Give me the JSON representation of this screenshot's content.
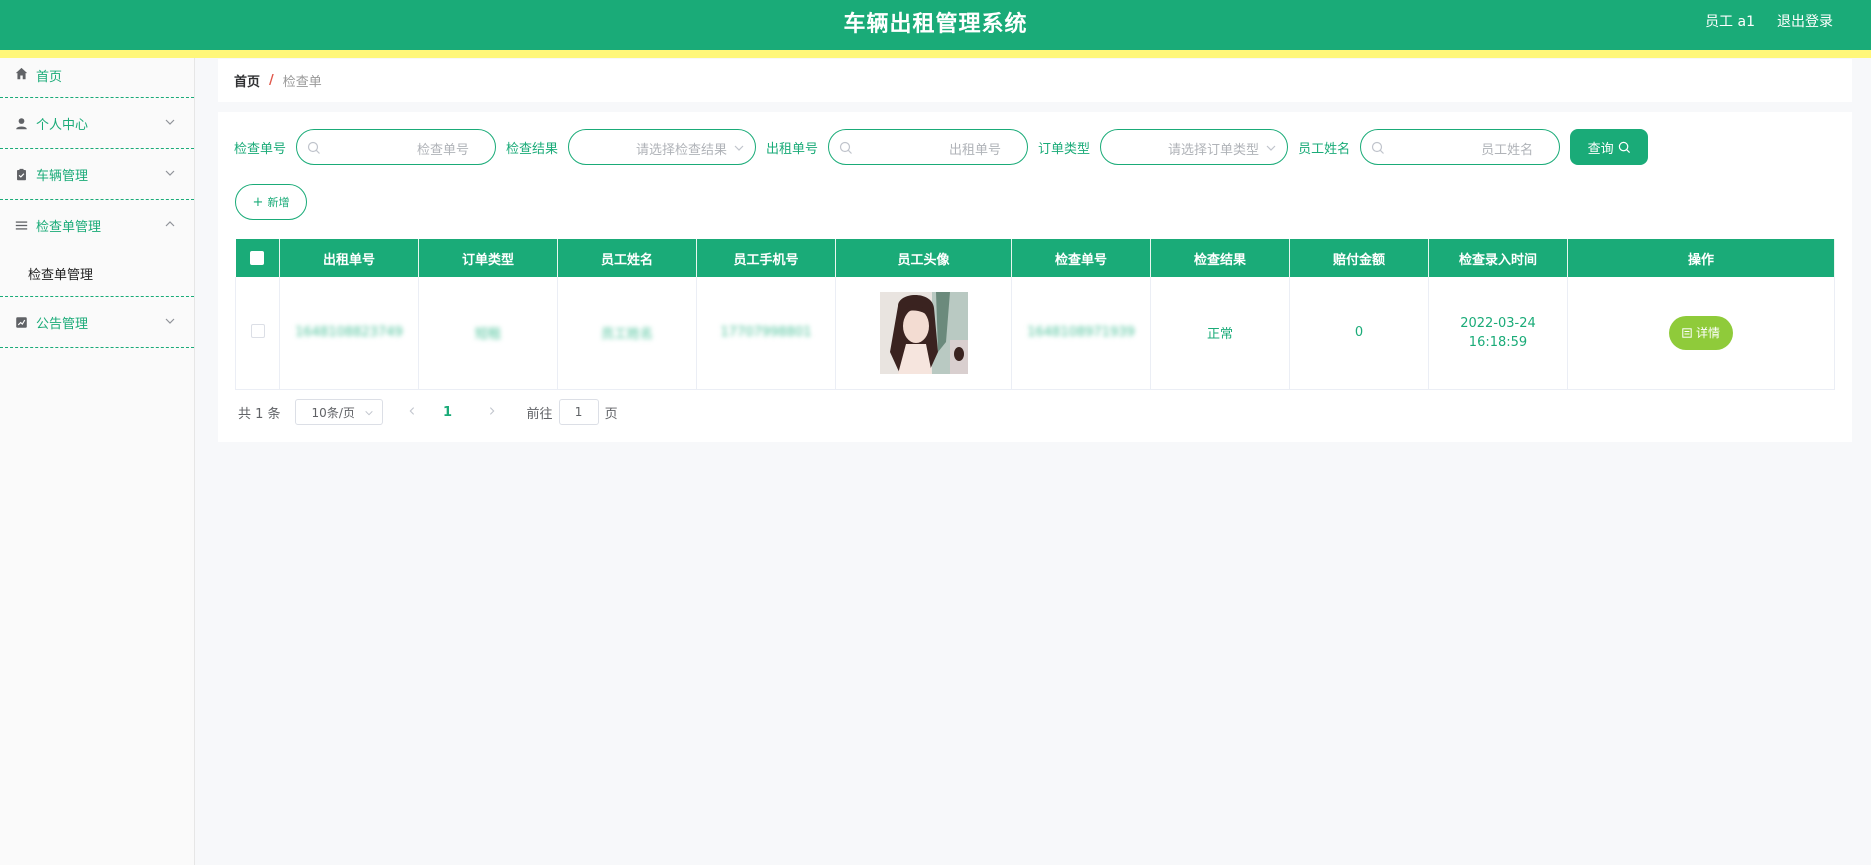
{
  "header": {
    "title": "车辆出租管理系统",
    "user": "员工 a1",
    "logout": "退出登录"
  },
  "sidebar": {
    "items": [
      {
        "label": "首页",
        "icon": "home-icon"
      },
      {
        "label": "个人中心",
        "icon": "user-icon"
      },
      {
        "label": "车辆管理",
        "icon": "clipboard-icon"
      },
      {
        "label": "检查单管理",
        "icon": "list-icon"
      },
      {
        "label": "公告管理",
        "icon": "chart-icon"
      }
    ],
    "submenu": "检查单管理"
  },
  "breadcrumb": {
    "home": "首页",
    "separator": "/",
    "current": "检查单"
  },
  "search": {
    "check_no_label": "检查单号",
    "check_no_placeholder": "检查单号",
    "result_label": "检查结果",
    "result_placeholder": "请选择检查结果",
    "rental_no_label": "出租单号",
    "rental_no_placeholder": "出租单号",
    "order_type_label": "订单类型",
    "order_type_placeholder": "请选择订单类型",
    "employee_label": "员工姓名",
    "employee_placeholder": "员工姓名",
    "query_button": "查询"
  },
  "actions": {
    "add_button": "新增"
  },
  "table": {
    "columns": [
      "出租单号",
      "订单类型",
      "员工姓名",
      "员工手机号",
      "员工头像",
      "检查单号",
      "检查结果",
      "赔付金额",
      "检查录入时间",
      "操作"
    ],
    "rows": [
      {
        "rental_no": "1648108823749",
        "order_type": "短租",
        "employee_name": "员工姓名",
        "phone": "17707998801",
        "check_no": "1648108971939",
        "result": "正常",
        "amount": "0",
        "time": "2022-03-24 16:18:59",
        "action": "详情"
      }
    ]
  },
  "pagination": {
    "total": "共 1 条",
    "page_size": "10条/页",
    "current_page": "1",
    "goto_label": "前往",
    "goto_value": "1",
    "page_suffix": "页"
  }
}
